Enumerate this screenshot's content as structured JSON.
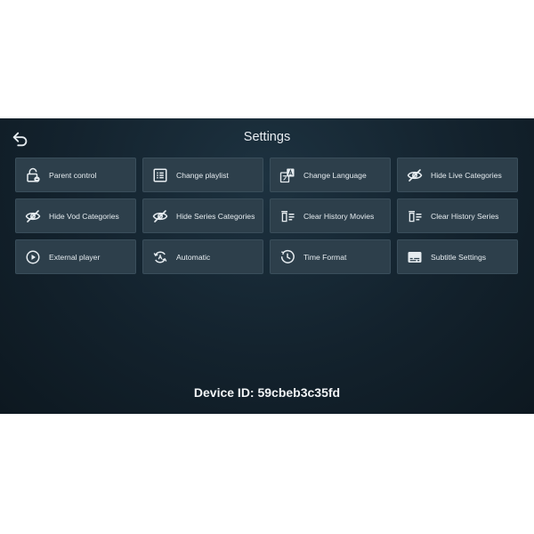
{
  "header": {
    "title": "Settings"
  },
  "settings": [
    {
      "label": "Parent control",
      "icon": "lock-icon"
    },
    {
      "label": "Change playlist",
      "icon": "list-icon"
    },
    {
      "label": "Change Language",
      "icon": "translate-icon"
    },
    {
      "label": "Hide Live Categories",
      "icon": "eye-off-icon"
    },
    {
      "label": "Hide Vod Categories",
      "icon": "eye-off-icon"
    },
    {
      "label": "Hide Series Categories",
      "icon": "eye-off-icon"
    },
    {
      "label": "Clear History Movies",
      "icon": "clear-list-icon"
    },
    {
      "label": "Clear History Series",
      "icon": "clear-list-icon"
    },
    {
      "label": "External player",
      "icon": "play-circle-icon"
    },
    {
      "label": "Automatic",
      "icon": "auto-refresh-icon"
    },
    {
      "label": "Time Format",
      "icon": "clock-icon"
    },
    {
      "label": "Subtitle Settings",
      "icon": "subtitles-icon"
    }
  ],
  "footer": {
    "device_id": "Device ID: 59cbeb3c35fd"
  },
  "colors": {
    "tile_background": "#2d3f4b",
    "screen_background": "#13222d",
    "text": "#e6ecf0"
  }
}
